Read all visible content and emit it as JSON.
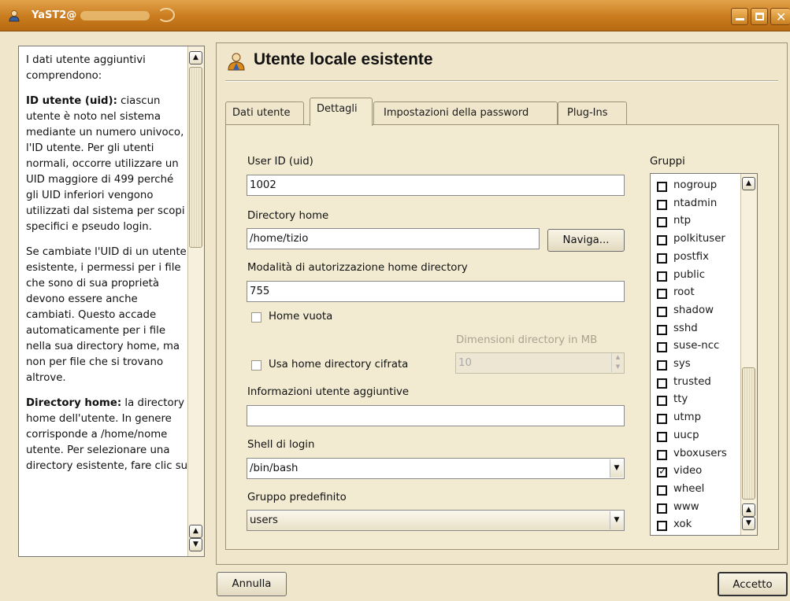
{
  "window": {
    "title": "YaST2@",
    "controls": [
      "minimize-icon",
      "maximize-icon",
      "close-icon"
    ]
  },
  "help": {
    "paragraphs": [
      {
        "bold": "",
        "text": "I dati utente aggiuntivi comprendono:"
      },
      {
        "bold": "ID utente (uid):",
        "text": " ciascun utente è noto nel sistema mediante un numero univoco, l'ID utente. Per gli utenti normali, occorre utilizzare un UID maggiore di 499 perché gli UID inferiori vengono utilizzati dal sistema per scopi specifici e pseudo login."
      },
      {
        "bold": "",
        "text": "Se cambiate l'UID di un utente esistente, i permessi per i file che sono di sua proprietà devono essere anche cambiati. Questo accade automaticamente per i file nella sua directory home, ma non per file che si trovano altrove."
      },
      {
        "bold": "Directory home:",
        "text": " la directory home dell'utente. In genere corrisponde a /home/nome utente. Per selezionare una directory esistente, fare clic su"
      }
    ]
  },
  "heading": "Utente locale esistente",
  "tabs": [
    {
      "label": "Dati utente",
      "active": false
    },
    {
      "label": "Dettagli",
      "active": true
    },
    {
      "label": "Impostazioni della password",
      "active": false
    },
    {
      "label": "Plug-Ins",
      "active": false
    }
  ],
  "form": {
    "uid_label": "User ID (uid)",
    "uid_value": "1002",
    "home_label": "Directory home",
    "home_value": "/home/tizio",
    "browse_label": "Naviga...",
    "perm_label": "Modalità di autorizzazione home directory",
    "perm_value": "755",
    "empty_home_label": "Home vuota",
    "dir_size_label": "Dimensioni directory in MB",
    "dir_size_value": "10",
    "encrypted_home_label": "Usa home directory cifrata",
    "extra_info_label": "Informazioni utente aggiuntive",
    "extra_info_value": "",
    "shell_label": "Shell di login",
    "shell_value": "/bin/bash",
    "default_group_label": "Gruppo predefinito",
    "default_group_value": "users"
  },
  "groups": {
    "label": "Gruppi",
    "items": [
      {
        "name": "nogroup",
        "checked": false
      },
      {
        "name": "ntadmin",
        "checked": false
      },
      {
        "name": "ntp",
        "checked": false
      },
      {
        "name": "polkituser",
        "checked": false
      },
      {
        "name": "postfix",
        "checked": false
      },
      {
        "name": "public",
        "checked": false
      },
      {
        "name": "root",
        "checked": false
      },
      {
        "name": "shadow",
        "checked": false
      },
      {
        "name": "sshd",
        "checked": false
      },
      {
        "name": "suse-ncc",
        "checked": false
      },
      {
        "name": "sys",
        "checked": false
      },
      {
        "name": "trusted",
        "checked": false
      },
      {
        "name": "tty",
        "checked": false
      },
      {
        "name": "utmp",
        "checked": false
      },
      {
        "name": "uucp",
        "checked": false
      },
      {
        "name": "vboxusers",
        "checked": false
      },
      {
        "name": "video",
        "checked": true
      },
      {
        "name": "wheel",
        "checked": false
      },
      {
        "name": "www",
        "checked": false
      },
      {
        "name": "xok",
        "checked": false
      }
    ]
  },
  "footer": {
    "cancel_label": "Annulla",
    "accept_label": "Accetto"
  }
}
